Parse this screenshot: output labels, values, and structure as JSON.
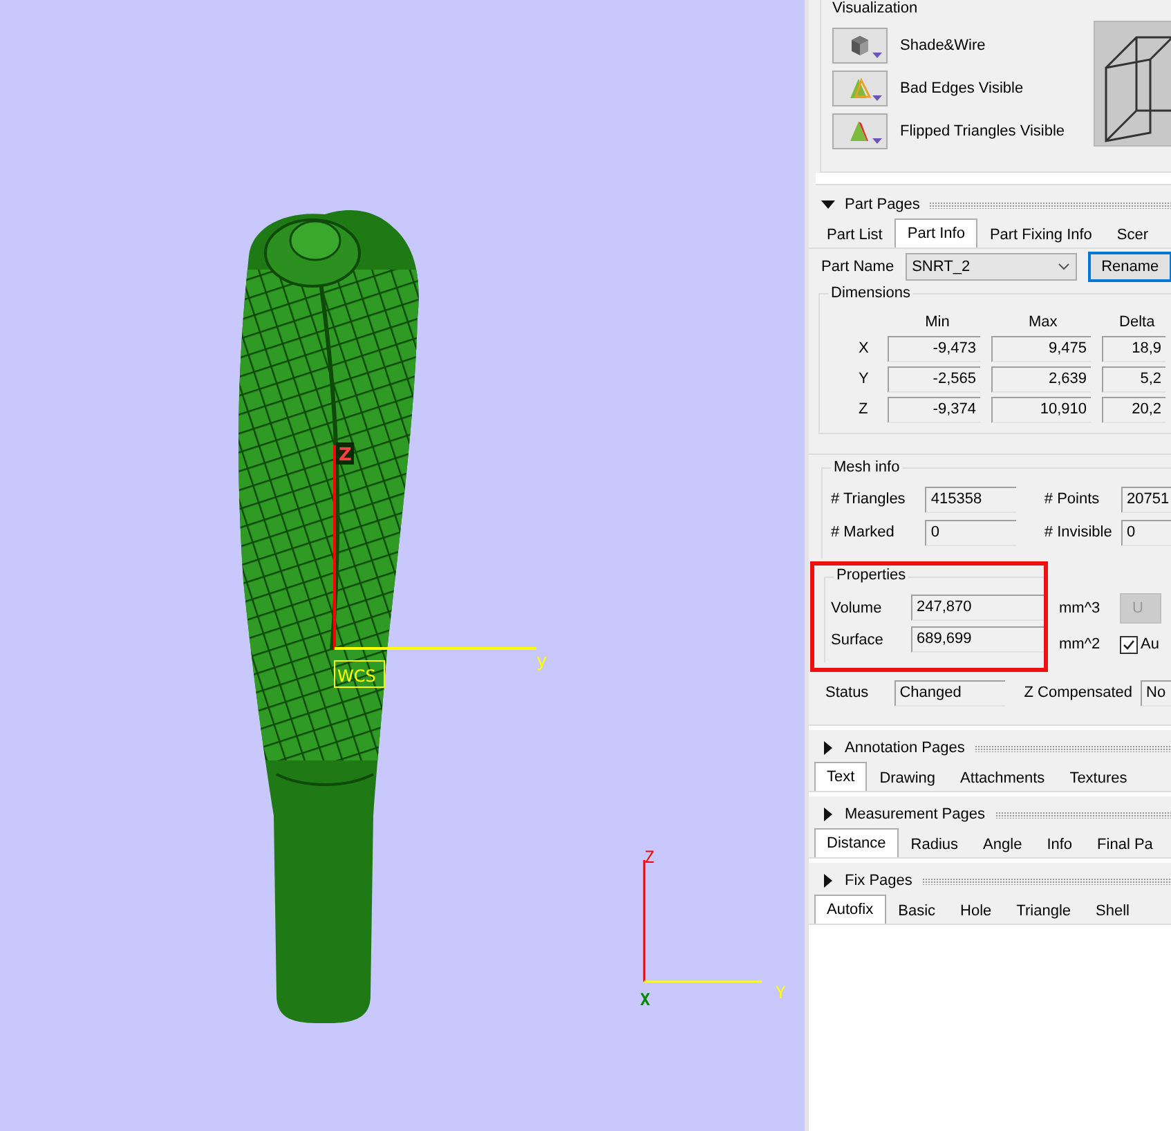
{
  "viewport": {
    "model_axes": {
      "z": "Z",
      "y": "y",
      "origin": "WCS"
    },
    "corner_triad": {
      "z": "Z",
      "x": "X",
      "y": "Y"
    }
  },
  "visualization": {
    "title": "Visualization",
    "options": [
      {
        "label": "Shade&Wire",
        "kind": "shade"
      },
      {
        "label": "Bad Edges Visible",
        "kind": "edges"
      },
      {
        "label": "Flipped Triangles Visible",
        "kind": "flipped"
      }
    ]
  },
  "part_pages": {
    "title": "Part Pages",
    "expanded": true,
    "tabs": [
      {
        "label": "Part List",
        "selected": false
      },
      {
        "label": "Part Info",
        "selected": true
      },
      {
        "label": "Part Fixing Info",
        "selected": false
      },
      {
        "label": "Scer",
        "selected": false
      }
    ],
    "part_name": {
      "label": "Part Name",
      "value": "SNRT_2",
      "button": "Rename"
    },
    "dimensions": {
      "title": "Dimensions",
      "columns": [
        "Min",
        "Max",
        "Delta"
      ],
      "rows": [
        {
          "axis": "X",
          "values": [
            "-9,473",
            "9,475",
            "18,9"
          ]
        },
        {
          "axis": "Y",
          "values": [
            "-2,565",
            "2,639",
            "5,2"
          ]
        },
        {
          "axis": "Z",
          "values": [
            "-9,374",
            "10,910",
            "20,2"
          ]
        }
      ]
    },
    "mesh_info": {
      "title": "Mesh info",
      "fields": [
        {
          "label": "# Triangles",
          "value": "415358"
        },
        {
          "label": "# Points",
          "value": "20751"
        },
        {
          "label": "# Marked",
          "value": "0"
        },
        {
          "label": "# Invisible",
          "value": "0"
        }
      ]
    },
    "properties": {
      "title": "Properties",
      "highlighted": true,
      "rows": [
        {
          "label": "Volume",
          "value": "247,870",
          "unit": "mm^3"
        },
        {
          "label": "Surface",
          "value": "689,699",
          "unit": "mm^2"
        }
      ],
      "update_button": {
        "label": "U",
        "disabled": true
      },
      "auto_checkbox": {
        "label": "Au",
        "checked": true
      }
    },
    "status": {
      "label": "Status",
      "value": "Changed",
      "z_label": "Z Compensated",
      "z_value": "No"
    }
  },
  "annotation_pages": {
    "title": "Annotation Pages",
    "expanded": false,
    "tabs": [
      {
        "label": "Text",
        "selected": true
      },
      {
        "label": "Drawing",
        "selected": false
      },
      {
        "label": "Attachments",
        "selected": false
      },
      {
        "label": "Textures",
        "selected": false
      }
    ]
  },
  "measurement_pages": {
    "title": "Measurement Pages",
    "expanded": false,
    "tabs": [
      {
        "label": "Distance",
        "selected": true
      },
      {
        "label": "Radius",
        "selected": false
      },
      {
        "label": "Angle",
        "selected": false
      },
      {
        "label": "Info",
        "selected": false
      },
      {
        "label": "Final Pa",
        "selected": false
      }
    ]
  },
  "fix_pages": {
    "title": "Fix Pages",
    "expanded": false,
    "tabs": [
      {
        "label": "Autofix",
        "selected": true
      },
      {
        "label": "Basic",
        "selected": false
      },
      {
        "label": "Hole",
        "selected": false
      },
      {
        "label": "Triangle",
        "selected": false
      },
      {
        "label": "Shell",
        "selected": false
      }
    ]
  }
}
